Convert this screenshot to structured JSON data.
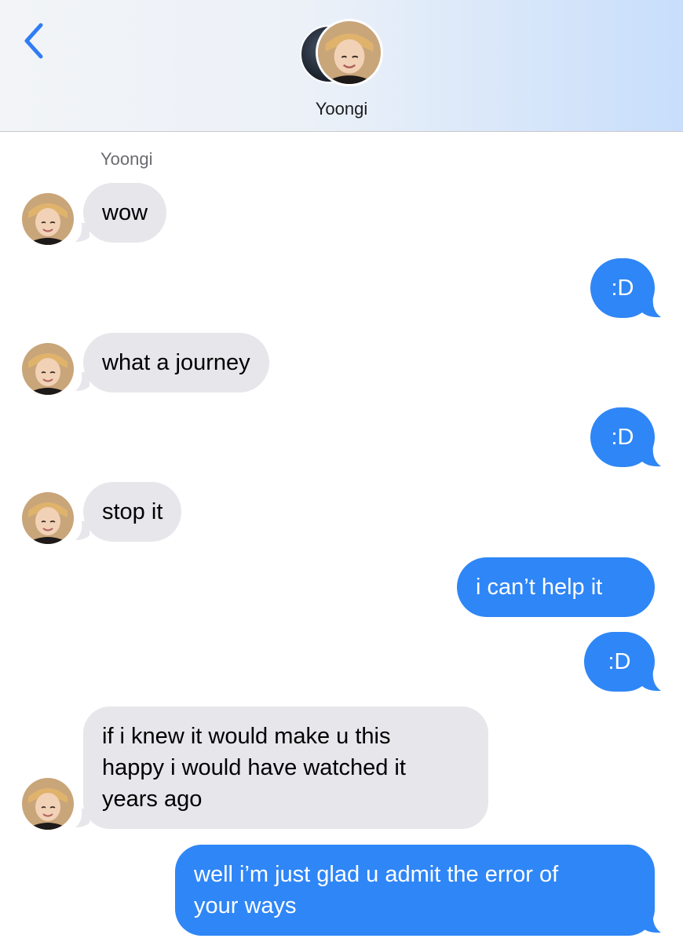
{
  "header": {
    "contact_name": "Yoongi",
    "back_icon": "chevron-left-icon"
  },
  "thread": {
    "sender_label": "Yoongi",
    "messages": [
      {
        "from": "them",
        "text": "wow"
      },
      {
        "from": "me",
        "text": ":D"
      },
      {
        "from": "them",
        "text": "what a journey"
      },
      {
        "from": "me",
        "text": ":D"
      },
      {
        "from": "them",
        "text": "stop it"
      },
      {
        "from": "me",
        "text": "i can’t help it"
      },
      {
        "from": "me",
        "text": ":D"
      },
      {
        "from": "them",
        "text": "if i knew it would make u this\nhappy i would have watched it\nyears ago"
      },
      {
        "from": "me",
        "text": "well i’m just glad u admit the error of\nyour ways"
      }
    ]
  },
  "colors": {
    "outgoing_bubble": "#2f86f6",
    "incoming_bubble": "#e6e6eb",
    "accent": "#2f7cf6"
  }
}
